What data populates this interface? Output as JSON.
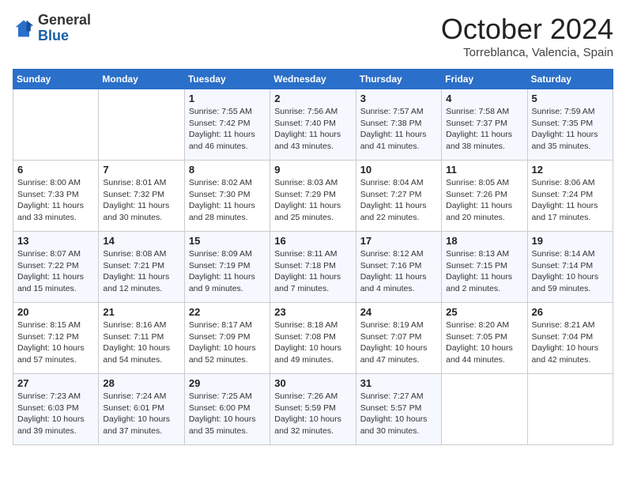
{
  "logo": {
    "general": "General",
    "blue": "Blue"
  },
  "title": "October 2024",
  "location": "Torreblanca, Valencia, Spain",
  "days_of_week": [
    "Sunday",
    "Monday",
    "Tuesday",
    "Wednesday",
    "Thursday",
    "Friday",
    "Saturday"
  ],
  "weeks": [
    [
      {
        "day": "",
        "sunrise": "",
        "sunset": "",
        "daylight": ""
      },
      {
        "day": "",
        "sunrise": "",
        "sunset": "",
        "daylight": ""
      },
      {
        "day": "1",
        "sunrise": "Sunrise: 7:55 AM",
        "sunset": "Sunset: 7:42 PM",
        "daylight": "Daylight: 11 hours and 46 minutes."
      },
      {
        "day": "2",
        "sunrise": "Sunrise: 7:56 AM",
        "sunset": "Sunset: 7:40 PM",
        "daylight": "Daylight: 11 hours and 43 minutes."
      },
      {
        "day": "3",
        "sunrise": "Sunrise: 7:57 AM",
        "sunset": "Sunset: 7:38 PM",
        "daylight": "Daylight: 11 hours and 41 minutes."
      },
      {
        "day": "4",
        "sunrise": "Sunrise: 7:58 AM",
        "sunset": "Sunset: 7:37 PM",
        "daylight": "Daylight: 11 hours and 38 minutes."
      },
      {
        "day": "5",
        "sunrise": "Sunrise: 7:59 AM",
        "sunset": "Sunset: 7:35 PM",
        "daylight": "Daylight: 11 hours and 35 minutes."
      }
    ],
    [
      {
        "day": "6",
        "sunrise": "Sunrise: 8:00 AM",
        "sunset": "Sunset: 7:33 PM",
        "daylight": "Daylight: 11 hours and 33 minutes."
      },
      {
        "day": "7",
        "sunrise": "Sunrise: 8:01 AM",
        "sunset": "Sunset: 7:32 PM",
        "daylight": "Daylight: 11 hours and 30 minutes."
      },
      {
        "day": "8",
        "sunrise": "Sunrise: 8:02 AM",
        "sunset": "Sunset: 7:30 PM",
        "daylight": "Daylight: 11 hours and 28 minutes."
      },
      {
        "day": "9",
        "sunrise": "Sunrise: 8:03 AM",
        "sunset": "Sunset: 7:29 PM",
        "daylight": "Daylight: 11 hours and 25 minutes."
      },
      {
        "day": "10",
        "sunrise": "Sunrise: 8:04 AM",
        "sunset": "Sunset: 7:27 PM",
        "daylight": "Daylight: 11 hours and 22 minutes."
      },
      {
        "day": "11",
        "sunrise": "Sunrise: 8:05 AM",
        "sunset": "Sunset: 7:26 PM",
        "daylight": "Daylight: 11 hours and 20 minutes."
      },
      {
        "day": "12",
        "sunrise": "Sunrise: 8:06 AM",
        "sunset": "Sunset: 7:24 PM",
        "daylight": "Daylight: 11 hours and 17 minutes."
      }
    ],
    [
      {
        "day": "13",
        "sunrise": "Sunrise: 8:07 AM",
        "sunset": "Sunset: 7:22 PM",
        "daylight": "Daylight: 11 hours and 15 minutes."
      },
      {
        "day": "14",
        "sunrise": "Sunrise: 8:08 AM",
        "sunset": "Sunset: 7:21 PM",
        "daylight": "Daylight: 11 hours and 12 minutes."
      },
      {
        "day": "15",
        "sunrise": "Sunrise: 8:09 AM",
        "sunset": "Sunset: 7:19 PM",
        "daylight": "Daylight: 11 hours and 9 minutes."
      },
      {
        "day": "16",
        "sunrise": "Sunrise: 8:11 AM",
        "sunset": "Sunset: 7:18 PM",
        "daylight": "Daylight: 11 hours and 7 minutes."
      },
      {
        "day": "17",
        "sunrise": "Sunrise: 8:12 AM",
        "sunset": "Sunset: 7:16 PM",
        "daylight": "Daylight: 11 hours and 4 minutes."
      },
      {
        "day": "18",
        "sunrise": "Sunrise: 8:13 AM",
        "sunset": "Sunset: 7:15 PM",
        "daylight": "Daylight: 11 hours and 2 minutes."
      },
      {
        "day": "19",
        "sunrise": "Sunrise: 8:14 AM",
        "sunset": "Sunset: 7:14 PM",
        "daylight": "Daylight: 10 hours and 59 minutes."
      }
    ],
    [
      {
        "day": "20",
        "sunrise": "Sunrise: 8:15 AM",
        "sunset": "Sunset: 7:12 PM",
        "daylight": "Daylight: 10 hours and 57 minutes."
      },
      {
        "day": "21",
        "sunrise": "Sunrise: 8:16 AM",
        "sunset": "Sunset: 7:11 PM",
        "daylight": "Daylight: 10 hours and 54 minutes."
      },
      {
        "day": "22",
        "sunrise": "Sunrise: 8:17 AM",
        "sunset": "Sunset: 7:09 PM",
        "daylight": "Daylight: 10 hours and 52 minutes."
      },
      {
        "day": "23",
        "sunrise": "Sunrise: 8:18 AM",
        "sunset": "Sunset: 7:08 PM",
        "daylight": "Daylight: 10 hours and 49 minutes."
      },
      {
        "day": "24",
        "sunrise": "Sunrise: 8:19 AM",
        "sunset": "Sunset: 7:07 PM",
        "daylight": "Daylight: 10 hours and 47 minutes."
      },
      {
        "day": "25",
        "sunrise": "Sunrise: 8:20 AM",
        "sunset": "Sunset: 7:05 PM",
        "daylight": "Daylight: 10 hours and 44 minutes."
      },
      {
        "day": "26",
        "sunrise": "Sunrise: 8:21 AM",
        "sunset": "Sunset: 7:04 PM",
        "daylight": "Daylight: 10 hours and 42 minutes."
      }
    ],
    [
      {
        "day": "27",
        "sunrise": "Sunrise: 7:23 AM",
        "sunset": "Sunset: 6:03 PM",
        "daylight": "Daylight: 10 hours and 39 minutes."
      },
      {
        "day": "28",
        "sunrise": "Sunrise: 7:24 AM",
        "sunset": "Sunset: 6:01 PM",
        "daylight": "Daylight: 10 hours and 37 minutes."
      },
      {
        "day": "29",
        "sunrise": "Sunrise: 7:25 AM",
        "sunset": "Sunset: 6:00 PM",
        "daylight": "Daylight: 10 hours and 35 minutes."
      },
      {
        "day": "30",
        "sunrise": "Sunrise: 7:26 AM",
        "sunset": "Sunset: 5:59 PM",
        "daylight": "Daylight: 10 hours and 32 minutes."
      },
      {
        "day": "31",
        "sunrise": "Sunrise: 7:27 AM",
        "sunset": "Sunset: 5:57 PM",
        "daylight": "Daylight: 10 hours and 30 minutes."
      },
      {
        "day": "",
        "sunrise": "",
        "sunset": "",
        "daylight": ""
      },
      {
        "day": "",
        "sunrise": "",
        "sunset": "",
        "daylight": ""
      }
    ]
  ]
}
